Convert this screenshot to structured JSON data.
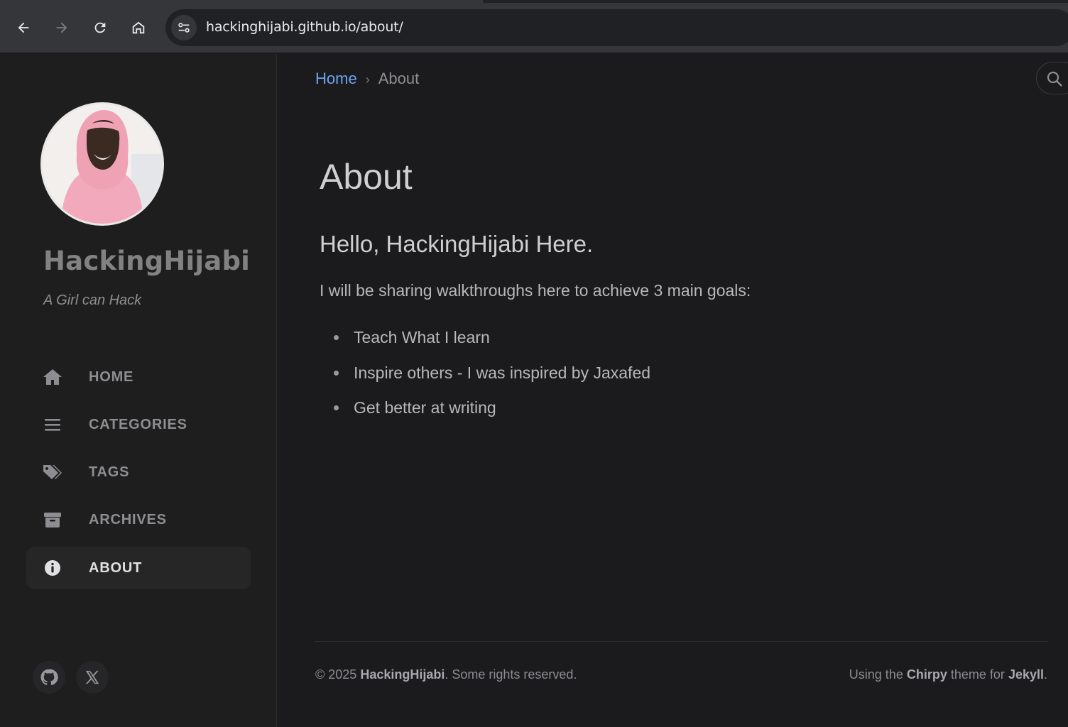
{
  "browser": {
    "url": "hackinghijabi.github.io/about/"
  },
  "sidebar": {
    "title": "HackingHijabi",
    "subtitle": "A Girl can Hack",
    "items": [
      {
        "label": "HOME",
        "icon": "home-icon"
      },
      {
        "label": "CATEGORIES",
        "icon": "list-icon"
      },
      {
        "label": "TAGS",
        "icon": "tags-icon"
      },
      {
        "label": "ARCHIVES",
        "icon": "archive-icon"
      },
      {
        "label": "ABOUT",
        "icon": "info-icon",
        "active": true
      }
    ],
    "social": [
      {
        "icon": "github-icon"
      },
      {
        "icon": "x-twitter-icon"
      }
    ]
  },
  "breadcrumb": {
    "home": "Home",
    "separator": "›",
    "current": "About"
  },
  "main": {
    "title": "About",
    "heading": "Hello, HackingHijabi Here.",
    "paragraph": "I will be sharing walkthroughs here to achieve 3 main goals:",
    "goals": [
      "Teach What I learn",
      "Inspire others - I was inspired by Jaxafed",
      "Get better at writing"
    ]
  },
  "footer": {
    "copyright_prefix": "© 2025",
    "owner": "HackingHijabi",
    "rights": ". Some rights reserved.",
    "using_the": "Using the",
    "theme": "Chirpy",
    "theme_for": "theme for",
    "engine": "Jekyll",
    "end": "."
  },
  "colors": {
    "background": "#1b1b1e",
    "sidebar": "#1e1e1e",
    "link": "#6aa5ef"
  }
}
